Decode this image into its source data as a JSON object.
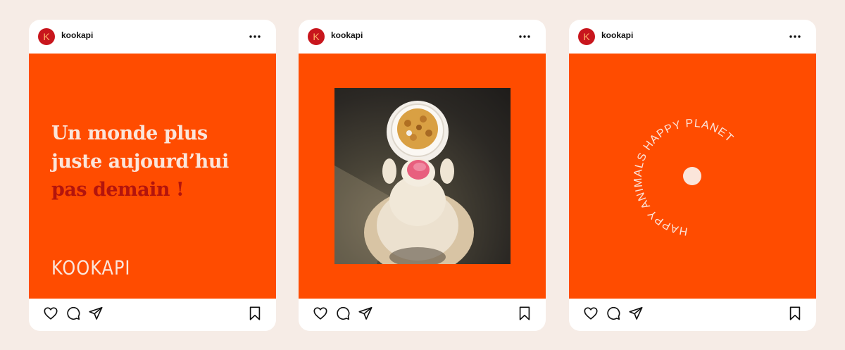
{
  "posts": [
    {
      "username": "kookapi",
      "avatar_letter": "K",
      "headline_line1": "Un monde plus",
      "headline_line2": "juste aujourd’hui",
      "headline_line3": "pas demain !",
      "brand_wordmark": "KOOKAPI"
    },
    {
      "username": "kookapi",
      "avatar_letter": "K"
    },
    {
      "username": "kookapi",
      "avatar_letter": "K",
      "circular_text": "HAPPY ANIMALS HAPPY PLANET"
    }
  ],
  "colors": {
    "background": "#f6ece6",
    "post_orange": "#ff4c00",
    "headline_cream": "#fbe5da",
    "headline_red": "#b3140d",
    "avatar_red": "#c8161d"
  },
  "icons": [
    "more-icon",
    "heart-icon",
    "comment-icon",
    "share-icon",
    "bookmark-icon"
  ]
}
